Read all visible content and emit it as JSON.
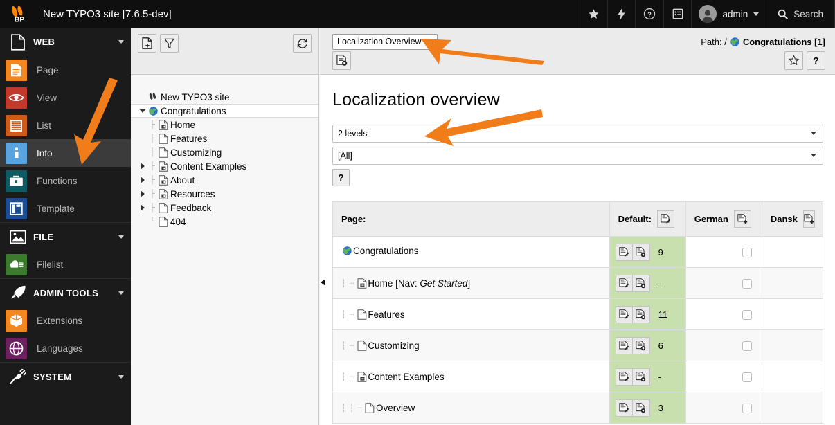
{
  "topbar": {
    "site_title": "New TYPO3 site [7.6.5-dev]",
    "logo_text": "BP",
    "bookmark_icon": "star-icon",
    "flash_icon": "bolt-icon",
    "help_icon": "question-circle-icon",
    "list_icon": "clipboard-list-icon",
    "user_label": "admin",
    "search_label": "Search"
  },
  "modulemenu": {
    "groups": [
      {
        "label": "WEB",
        "icon": "page-document-icon",
        "items": [
          {
            "label": "Page",
            "icon": "page-icon",
            "color": "#f3861f",
            "active": false
          },
          {
            "label": "View",
            "icon": "eye-icon",
            "color": "#c0392b",
            "active": false
          },
          {
            "label": "List",
            "icon": "list-icon",
            "color": "#cd5c1a",
            "active": false
          },
          {
            "label": "Info",
            "icon": "info-icon",
            "color": "#5ba3dc",
            "active": true
          },
          {
            "label": "Functions",
            "icon": "toolbox-icon",
            "color": "#0d5a63",
            "active": false
          },
          {
            "label": "Template",
            "icon": "template-icon",
            "color": "#1c4d94",
            "active": false
          }
        ]
      },
      {
        "label": "FILE",
        "icon": "image-icon",
        "items": [
          {
            "label": "Filelist",
            "icon": "folder-cloud-icon",
            "color": "#3c7a2e",
            "active": false
          }
        ]
      },
      {
        "label": "ADMIN TOOLS",
        "icon": "rocket-icon",
        "items": [
          {
            "label": "Extensions",
            "icon": "box-icon",
            "color": "#f3861f",
            "active": false
          },
          {
            "label": "Languages",
            "icon": "globe-icon",
            "color": "#6b2060",
            "active": false
          }
        ]
      },
      {
        "label": "SYSTEM",
        "icon": "plug-icon",
        "items": []
      }
    ]
  },
  "navframe": {
    "new_page_button": "new-page-icon",
    "filter_button": "filter-icon",
    "refresh_button": "refresh-icon",
    "tree": [
      {
        "label": "New TYPO3 site",
        "depth": 0,
        "icon": "typo3-root-icon",
        "toggle": "none",
        "selected": false,
        "last": false
      },
      {
        "label": "Congratulations",
        "depth": 1,
        "icon": "globe-page-icon",
        "toggle": "expanded",
        "selected": true,
        "last": false
      },
      {
        "label": "Home",
        "depth": 2,
        "icon": "page-shortcut-icon",
        "toggle": "none",
        "selected": false,
        "last": false
      },
      {
        "label": "Features",
        "depth": 2,
        "icon": "page-plain-icon",
        "toggle": "none",
        "selected": false,
        "last": false
      },
      {
        "label": "Customizing",
        "depth": 2,
        "icon": "page-plain-icon",
        "toggle": "none",
        "selected": false,
        "last": false
      },
      {
        "label": "Content Examples",
        "depth": 2,
        "icon": "page-shortcut-icon",
        "toggle": "collapsed",
        "selected": false,
        "last": false
      },
      {
        "label": "About",
        "depth": 2,
        "icon": "page-shortcut-icon",
        "toggle": "collapsed",
        "selected": false,
        "last": false
      },
      {
        "label": "Resources",
        "depth": 2,
        "icon": "page-shortcut-icon",
        "toggle": "collapsed",
        "selected": false,
        "last": false
      },
      {
        "label": "Feedback",
        "depth": 2,
        "icon": "page-plain-icon",
        "toggle": "collapsed",
        "selected": false,
        "last": false
      },
      {
        "label": "404",
        "depth": 2,
        "icon": "page-plain-icon",
        "toggle": "none",
        "selected": false,
        "last": true
      }
    ]
  },
  "docheader": {
    "module_select_value": "Localization Overview",
    "module_select_options": [
      "Localization Overview"
    ],
    "page_info_button": "page-information-icon",
    "path_prefix": "Path: /",
    "path_page": "Congratulations [1]",
    "bookmark_button": "star-outline-icon",
    "help_button": "?"
  },
  "main": {
    "title": "Localization overview",
    "depth_select_value": "2 levels",
    "depth_select_options": [
      "2 levels"
    ],
    "lang_select_value": "[All]",
    "lang_select_options": [
      "[All]"
    ],
    "help_button_label": "?",
    "table": {
      "columns": [
        {
          "key": "page",
          "label": "Page:",
          "icon": null
        },
        {
          "key": "default",
          "label": "Default:",
          "icon": "edit-records-icon"
        },
        {
          "key": "german",
          "label": "German",
          "icon": "new-translation-icon"
        },
        {
          "key": "dansk",
          "label": "Dansk",
          "icon": "new-translation-icon"
        }
      ],
      "rows": [
        {
          "title": "Congratulations",
          "nav": null,
          "depth": 0,
          "icon": "globe-page-icon",
          "default_count": "9",
          "german_checkbox": true,
          "dansk": ""
        },
        {
          "title": "Home",
          "nav": "Get Started",
          "depth": 1,
          "icon": "page-shortcut-icon",
          "default_count": "-",
          "german_checkbox": true,
          "dansk": ""
        },
        {
          "title": "Features",
          "nav": null,
          "depth": 1,
          "icon": "page-plain-icon",
          "default_count": "11",
          "german_checkbox": true,
          "dansk": ""
        },
        {
          "title": "Customizing",
          "nav": null,
          "depth": 1,
          "icon": "page-plain-icon",
          "default_count": "6",
          "german_checkbox": true,
          "dansk": ""
        },
        {
          "title": "Content Examples",
          "nav": null,
          "depth": 1,
          "icon": "page-shortcut-icon",
          "default_count": "-",
          "german_checkbox": true,
          "dansk": ""
        },
        {
          "title": "Overview",
          "nav": null,
          "depth": 2,
          "icon": "page-plain-icon",
          "default_count": "3",
          "german_checkbox": true,
          "dansk": ""
        }
      ],
      "row_edit_icon": "edit-record-icon",
      "row_info_icon": "record-info-icon"
    }
  },
  "annotations": {
    "arrow_color": "#f07d1a",
    "arrows": [
      {
        "name": "arrow-to-info-module"
      },
      {
        "name": "arrow-to-module-select"
      },
      {
        "name": "arrow-to-depth-select"
      }
    ]
  }
}
